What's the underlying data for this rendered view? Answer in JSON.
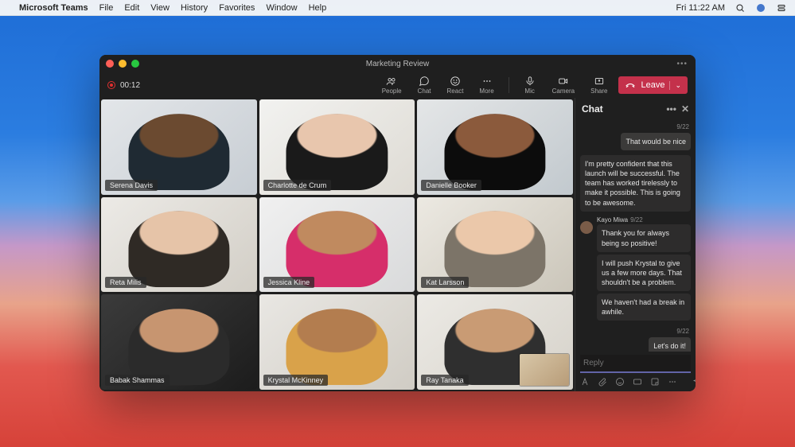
{
  "menubar": {
    "app_name": "Microsoft Teams",
    "items": [
      "File",
      "Edit",
      "View",
      "History",
      "Favorites",
      "Window",
      "Help"
    ],
    "clock": "Fri 11:22 AM"
  },
  "window": {
    "title": "Marketing Review"
  },
  "call": {
    "timer": "00:12",
    "controls": {
      "people": "People",
      "chat": "Chat",
      "react": "React",
      "more": "More",
      "mic": "Mic",
      "camera": "Camera",
      "share": "Share"
    },
    "leave_label": "Leave"
  },
  "participants": [
    {
      "name": "Serena Davis",
      "bg": "linear-gradient(140deg,#e3e6e9,#c7cdd3)",
      "skin": "#6b4a30",
      "top": "#1f2a33"
    },
    {
      "name": "Charlotte de Crum",
      "bg": "linear-gradient(140deg,#f2f2f0,#dedbd4)",
      "skin": "#e8c6ad",
      "top": "#1a1a1a"
    },
    {
      "name": "Danielle Booker",
      "bg": "linear-gradient(140deg,#e4e6e7,#c2c9ce)",
      "skin": "#8b5a3c",
      "top": "#0c0c0c"
    },
    {
      "name": "Reta Milis",
      "bg": "linear-gradient(140deg,#eceae6,#d2cec6)",
      "skin": "#e6c4a8",
      "top": "#2f2a25"
    },
    {
      "name": "Jessica Kline",
      "bg": "linear-gradient(140deg,#f0f0f0,#d9dadb)",
      "skin": "#c08a5f",
      "top": "#d62e6a"
    },
    {
      "name": "Kat Larsson",
      "bg": "linear-gradient(140deg,#ece9e2,#cbc6ba)",
      "skin": "#ebc8aa",
      "top": "#7c7468"
    },
    {
      "name": "Babak Shammas",
      "bg": "linear-gradient(140deg,#3b3b3b,#1c1c1c)",
      "skin": "#c79570",
      "top": "#2b2b2b"
    },
    {
      "name": "Krystal McKinney",
      "bg": "linear-gradient(140deg,#e9e7e3,#d0ccc4)",
      "skin": "#b37d4f",
      "top": "#d9a24a"
    },
    {
      "name": "Ray Tanaka",
      "bg": "linear-gradient(140deg,#eceae5,#d6d2ca)",
      "skin": "#c99b74",
      "top": "#2f2f2f"
    }
  ],
  "chat": {
    "title": "Chat",
    "messages": [
      {
        "side": "right",
        "time": "9/22",
        "text": "That would be nice"
      },
      {
        "side": "left",
        "time": "",
        "text": "I'm pretty confident that this launch will be successful. The team has worked tirelessly to make it possible. This is going to be awesome."
      },
      {
        "side": "left",
        "author": "Kayo Miwa",
        "time": "9/22",
        "avatar": true,
        "texts": [
          "Thank you for always being so positive!",
          "I will push Krystal to give us a few more days. That shouldn't be a problem.",
          "We haven't had a break in awhile."
        ]
      },
      {
        "side": "right",
        "time": "9/22",
        "text": "Let's do it!"
      }
    ],
    "reply_placeholder": "Reply"
  }
}
